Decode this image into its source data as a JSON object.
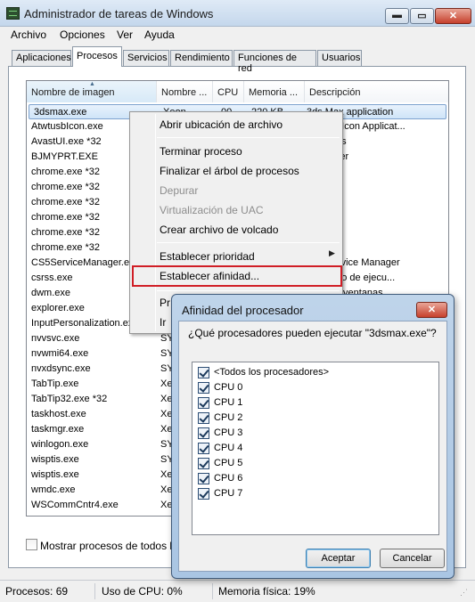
{
  "window": {
    "title": "Administrador de tareas de Windows",
    "controls": {
      "minimize": "▬",
      "maximize": "▭",
      "close": "✕"
    }
  },
  "menu": [
    "Archivo",
    "Opciones",
    "Ver",
    "Ayuda"
  ],
  "tabs": [
    {
      "label": "Aplicaciones",
      "active": false
    },
    {
      "label": "Procesos",
      "active": true
    },
    {
      "label": "Servicios",
      "active": false
    },
    {
      "label": "Rendimiento",
      "active": false
    },
    {
      "label": "Funciones de red",
      "active": false
    },
    {
      "label": "Usuarios",
      "active": false
    }
  ],
  "table": {
    "sort_indicator": "▲",
    "columns": [
      "Nombre de imagen",
      "Nombre ...",
      "CPU",
      "Memoria ...",
      "Descripción"
    ],
    "rows": [
      {
        "name": "3dsmax.exe",
        "user": "Xeon",
        "cpu": "00",
        "mem": "220 KB",
        "desc": "3ds Max application",
        "selected": true
      },
      {
        "name": "AtwtusbIcon.exe",
        "desc": "Atwtusb Icon Applicat..."
      },
      {
        "name": "AvastUI.exe *32",
        "desc": "t Antivirus"
      },
      {
        "name": "BJMYPRT.EXE",
        "desc": "My Printer"
      },
      {
        "name": "chrome.exe *32",
        "desc": "Chrome"
      },
      {
        "name": "chrome.exe *32",
        "desc": "Chrome"
      },
      {
        "name": "chrome.exe *32",
        "desc": "Chrome"
      },
      {
        "name": "chrome.exe *32",
        "desc": "Chrome"
      },
      {
        "name": "chrome.exe *32",
        "desc": "Chrome"
      },
      {
        "name": "chrome.exe *32",
        "desc": "Chrome"
      },
      {
        "name": "CS5ServiceManager.ex",
        "desc": "CS5 Service Manager"
      },
      {
        "name": "csrss.exe",
        "desc": "en tiempo de ejecu..."
      },
      {
        "name": "dwm.exe",
        "desc": "rador de ventanas"
      },
      {
        "name": "explorer.exe",
        "desc": ""
      },
      {
        "name": "InputPersonalization.exe",
        "desc": ""
      },
      {
        "name": "nvvsvc.exe",
        "user": "SY",
        "desc": ""
      },
      {
        "name": "nvwmi64.exe",
        "user": "SY",
        "desc": ""
      },
      {
        "name": "nvxdsync.exe",
        "user": "SY",
        "desc": ""
      },
      {
        "name": "TabTip.exe",
        "user": "Xe",
        "desc": ""
      },
      {
        "name": "TabTip32.exe *32",
        "user": "Xe",
        "desc": ""
      },
      {
        "name": "taskhost.exe",
        "user": "Xe",
        "desc": ""
      },
      {
        "name": "taskmgr.exe",
        "user": "Xe",
        "desc": ""
      },
      {
        "name": "winlogon.exe",
        "user": "SY",
        "desc": ""
      },
      {
        "name": "wisptis.exe",
        "user": "SY",
        "desc": ""
      },
      {
        "name": "wisptis.exe",
        "user": "Xe",
        "desc": ""
      },
      {
        "name": "wmdc.exe",
        "user": "Xe",
        "desc": ""
      },
      {
        "name": "WSCommCntr4.exe",
        "user": "Xe",
        "desc": ""
      }
    ]
  },
  "show_all_label": "Mostrar procesos de todos los",
  "context_menu": {
    "items": [
      {
        "label": "Abrir ubicación de archivo",
        "disabled": false
      },
      {
        "label": "Terminar proceso",
        "disabled": false
      },
      {
        "label": "Finalizar el árbol de procesos",
        "disabled": false
      },
      {
        "label": "Depurar",
        "disabled": true
      },
      {
        "label": "Virtualización de UAC",
        "disabled": true
      },
      {
        "label": "Crear archivo de volcado",
        "disabled": false
      },
      {
        "label": "Establecer prioridad",
        "disabled": false
      },
      {
        "label": "Establecer afinidad...",
        "disabled": false
      },
      {
        "label": "Pr",
        "disabled": false
      },
      {
        "label": "Ir",
        "disabled": false
      }
    ],
    "submenu_arrow": "▶"
  },
  "dialog": {
    "title": "Afinidad del procesador",
    "close": "✕",
    "question": "¿Qué procesadores pueden ejecutar \"3dsmax.exe\"?",
    "options": [
      "<Todos los procesadores>",
      "CPU 0",
      "CPU 1",
      "CPU 2",
      "CPU 3",
      "CPU 4",
      "CPU 5",
      "CPU 6",
      "CPU 7"
    ],
    "ok": "Aceptar",
    "cancel": "Cancelar"
  },
  "status": {
    "processes": "Procesos: 69",
    "cpu": "Uso de CPU: 0%",
    "memory": "Memoria física: 19%"
  },
  "colors": {
    "highlight_border": "#d01e26",
    "selection": "#cfe4f8"
  }
}
